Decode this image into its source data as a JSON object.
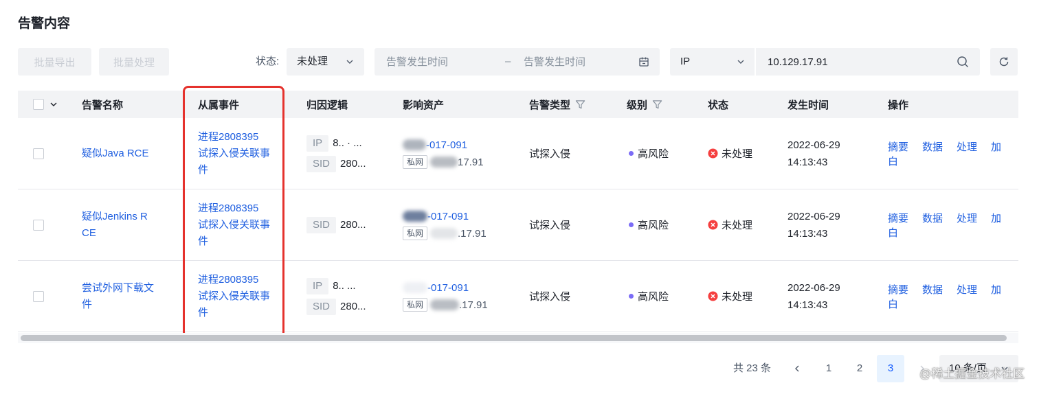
{
  "page": {
    "title": "告警内容"
  },
  "toolbar": {
    "batch_export_label": "批量导出",
    "batch_process_label": "批量处理",
    "status_filter": {
      "label": "状态:",
      "value": "未处理"
    },
    "date_range": {
      "start_placeholder": "告警发生时间",
      "separator": "–",
      "end_placeholder": "告警发生时间"
    },
    "search": {
      "field": "IP",
      "value": "10.129.17.91"
    }
  },
  "table": {
    "columns": [
      "告警名称",
      "从属事件",
      "归因逻辑",
      "影响资产",
      "告警类型",
      "级别",
      "状态",
      "发生时间",
      "操作"
    ],
    "rows": [
      {
        "name": "疑似Java RCE",
        "event": {
          "id": "进程2808395",
          "name": "试探入侵关联事件"
        },
        "attribution": [
          {
            "tag": "IP",
            "value": "8.. · ..."
          },
          {
            "tag": "SID",
            "value": "280..."
          }
        ],
        "asset": {
          "host": "-017-091",
          "network": "私网",
          "ip": "17.91"
        },
        "type": "试探入侵",
        "level": "高风险",
        "status": "未处理",
        "date": "2022-06-29",
        "time": "14:13:43",
        "actions": [
          "摘要",
          "数据",
          "处理",
          "加白"
        ]
      },
      {
        "name": "疑似Jenkins RCE",
        "event": {
          "id": "进程2808395",
          "name": "试探入侵关联事件"
        },
        "attribution": [
          {
            "tag": "SID",
            "value": "280..."
          }
        ],
        "asset": {
          "host": "-017-091",
          "network": "私网",
          "ip": ".17.91"
        },
        "type": "试探入侵",
        "level": "高风险",
        "status": "未处理",
        "date": "2022-06-29",
        "time": "14:13:43",
        "actions": [
          "摘要",
          "数据",
          "处理",
          "加白"
        ]
      },
      {
        "name": "尝试外网下载文件",
        "event": {
          "id": "进程2808395",
          "name": "试探入侵关联事件"
        },
        "attribution": [
          {
            "tag": "IP",
            "value": "8.. ..."
          },
          {
            "tag": "SID",
            "value": "280..."
          }
        ],
        "asset": {
          "host": "-017-091",
          "network": "私网",
          "ip": ".17.91"
        },
        "type": "试探入侵",
        "level": "高风险",
        "status": "未处理",
        "date": "2022-06-29",
        "time": "14:13:43",
        "actions": [
          "摘要",
          "数据",
          "处理",
          "加白"
        ]
      }
    ]
  },
  "pagination": {
    "total": "共 23 条",
    "pages": [
      "1",
      "2",
      "3"
    ],
    "current_page": 3,
    "page_size": "10 条/页"
  },
  "watermark": "@稀土掘金技术社区",
  "colors": {
    "accent": "#1f5fe0",
    "danger": "#f53f3f",
    "level_high": "#7b6cf6",
    "highlight": "#e5322d",
    "active_page_bg": "#e8f3ff"
  },
  "icons": {
    "dropdown": "chevron-down-icon",
    "date": "calendar-icon",
    "search": "search-icon",
    "refresh": "refresh-icon",
    "filter": "filter-icon",
    "status": "error-circle-icon",
    "prev": "chevron-left-icon",
    "next": "chevron-right-icon"
  }
}
